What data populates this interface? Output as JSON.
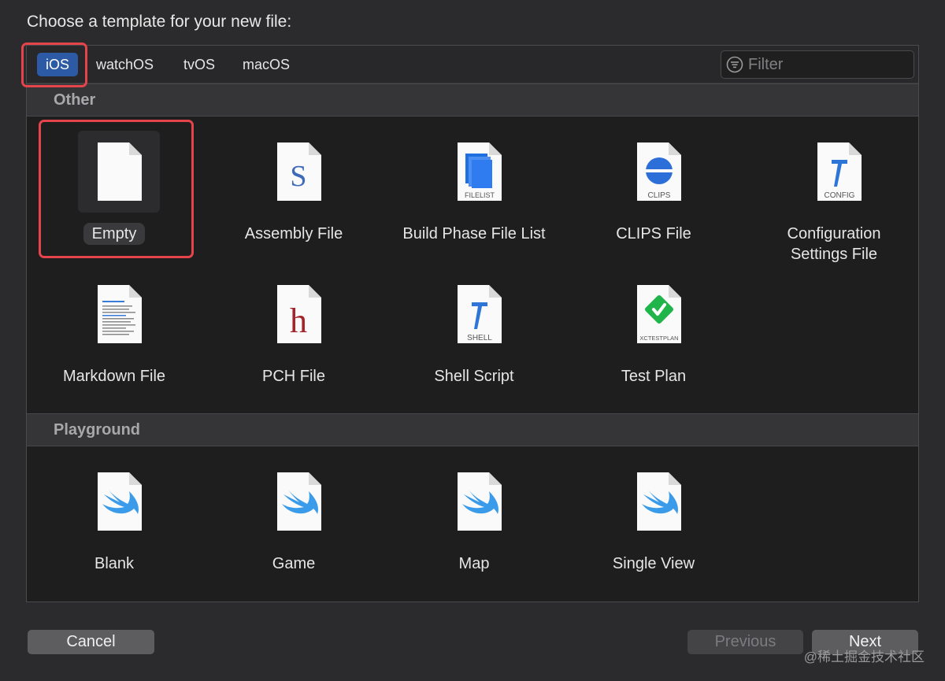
{
  "dialog": {
    "prompt": "Choose a template for your new file:"
  },
  "platform_tabs": [
    {
      "label": "iOS",
      "selected": true
    },
    {
      "label": "watchOS",
      "selected": false
    },
    {
      "label": "tvOS",
      "selected": false
    },
    {
      "label": "macOS",
      "selected": false
    }
  ],
  "filter": {
    "placeholder": "Filter",
    "value": ""
  },
  "sections": [
    {
      "title": "Other",
      "items": [
        {
          "label": "Empty",
          "icon": "blank-document-icon",
          "selected": true
        },
        {
          "label": "Assembly File",
          "icon": "assembly-s-icon",
          "glyph": "S"
        },
        {
          "label": "Build Phase File List",
          "icon": "filelist-icon",
          "caption": "FILELIST"
        },
        {
          "label": "CLIPS File",
          "icon": "clips-icon",
          "caption": "CLIPS"
        },
        {
          "label": "Configuration Settings File",
          "icon": "config-icon",
          "caption": "CONFIG"
        },
        {
          "label": "Markdown File",
          "icon": "markdown-icon"
        },
        {
          "label": "PCH File",
          "icon": "pch-h-icon",
          "glyph": "h"
        },
        {
          "label": "Shell Script",
          "icon": "shell-icon",
          "caption": "SHELL"
        },
        {
          "label": "Test Plan",
          "icon": "xctestplan-icon",
          "caption": "XCTESTPLAN"
        }
      ]
    },
    {
      "title": "Playground",
      "items": [
        {
          "label": "Blank",
          "icon": "swift-icon"
        },
        {
          "label": "Game",
          "icon": "swift-icon"
        },
        {
          "label": "Map",
          "icon": "swift-icon"
        },
        {
          "label": "Single View",
          "icon": "swift-icon"
        }
      ]
    }
  ],
  "buttons": {
    "cancel": "Cancel",
    "previous": "Previous",
    "next": "Next"
  },
  "watermark": "@稀土掘金技术社区",
  "colors": {
    "accent": "#2d5aa5",
    "highlight_box": "#e5444b",
    "swift": "#3a9bea",
    "assembly_s": "#3e6bb8",
    "pch_h": "#a5242a",
    "testplan_green": "#1fb54a"
  }
}
